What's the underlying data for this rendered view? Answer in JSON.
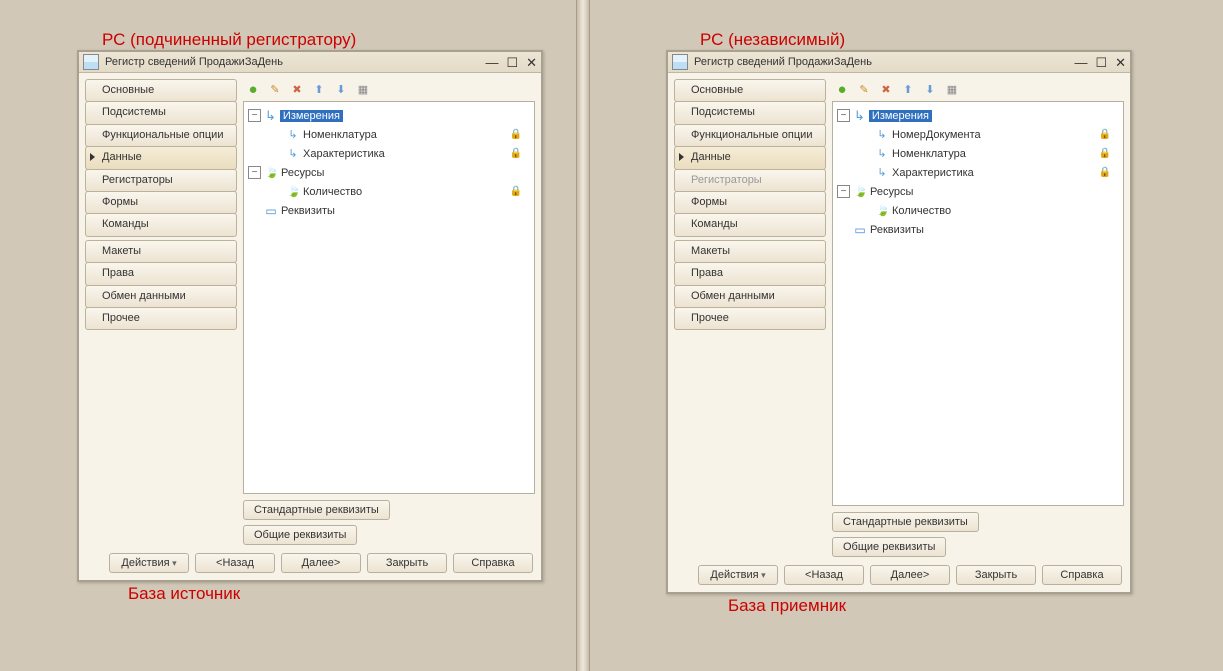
{
  "annotations": {
    "left_top": "РС (подчиненный регистратору)",
    "left_bottom": "База источник",
    "right_top": "РС (независимый)",
    "right_bottom": "База приемник"
  },
  "common": {
    "window_title": "Регистр сведений ПродажиЗаДень",
    "nav": [
      "Основные",
      "Подсистемы",
      "Функциональные опции",
      "Данные",
      "Регистраторы",
      "Формы",
      "Команды",
      "Макеты",
      "Права",
      "Обмен данными",
      "Прочее"
    ],
    "selected_nav": "Данные",
    "btn_standard": "Стандартные реквизиты",
    "btn_common": "Общие реквизиты",
    "footer": {
      "actions": "Действия",
      "back": "<Назад",
      "next": "Далее>",
      "close": "Закрыть",
      "help": "Справка"
    }
  },
  "left": {
    "disabled_nav": [],
    "tree": {
      "dimensions": {
        "label": "Измерения",
        "children": [
          {
            "label": "Номенклатура",
            "locked": true
          },
          {
            "label": "Характеристика",
            "locked": true
          }
        ]
      },
      "resources": {
        "label": "Ресурсы",
        "children": [
          {
            "label": "Количество",
            "locked": true
          }
        ]
      },
      "attributes": {
        "label": "Реквизиты",
        "children": []
      }
    }
  },
  "right": {
    "disabled_nav": [
      "Регистраторы"
    ],
    "tree": {
      "dimensions": {
        "label": "Измерения",
        "children": [
          {
            "label": "НомерДокумента",
            "locked": true
          },
          {
            "label": "Номенклатура",
            "locked": true
          },
          {
            "label": "Характеристика",
            "locked": true
          }
        ]
      },
      "resources": {
        "label": "Ресурсы",
        "children": [
          {
            "label": "Количество",
            "locked": false
          }
        ]
      },
      "attributes": {
        "label": "Реквизиты",
        "children": []
      }
    }
  }
}
